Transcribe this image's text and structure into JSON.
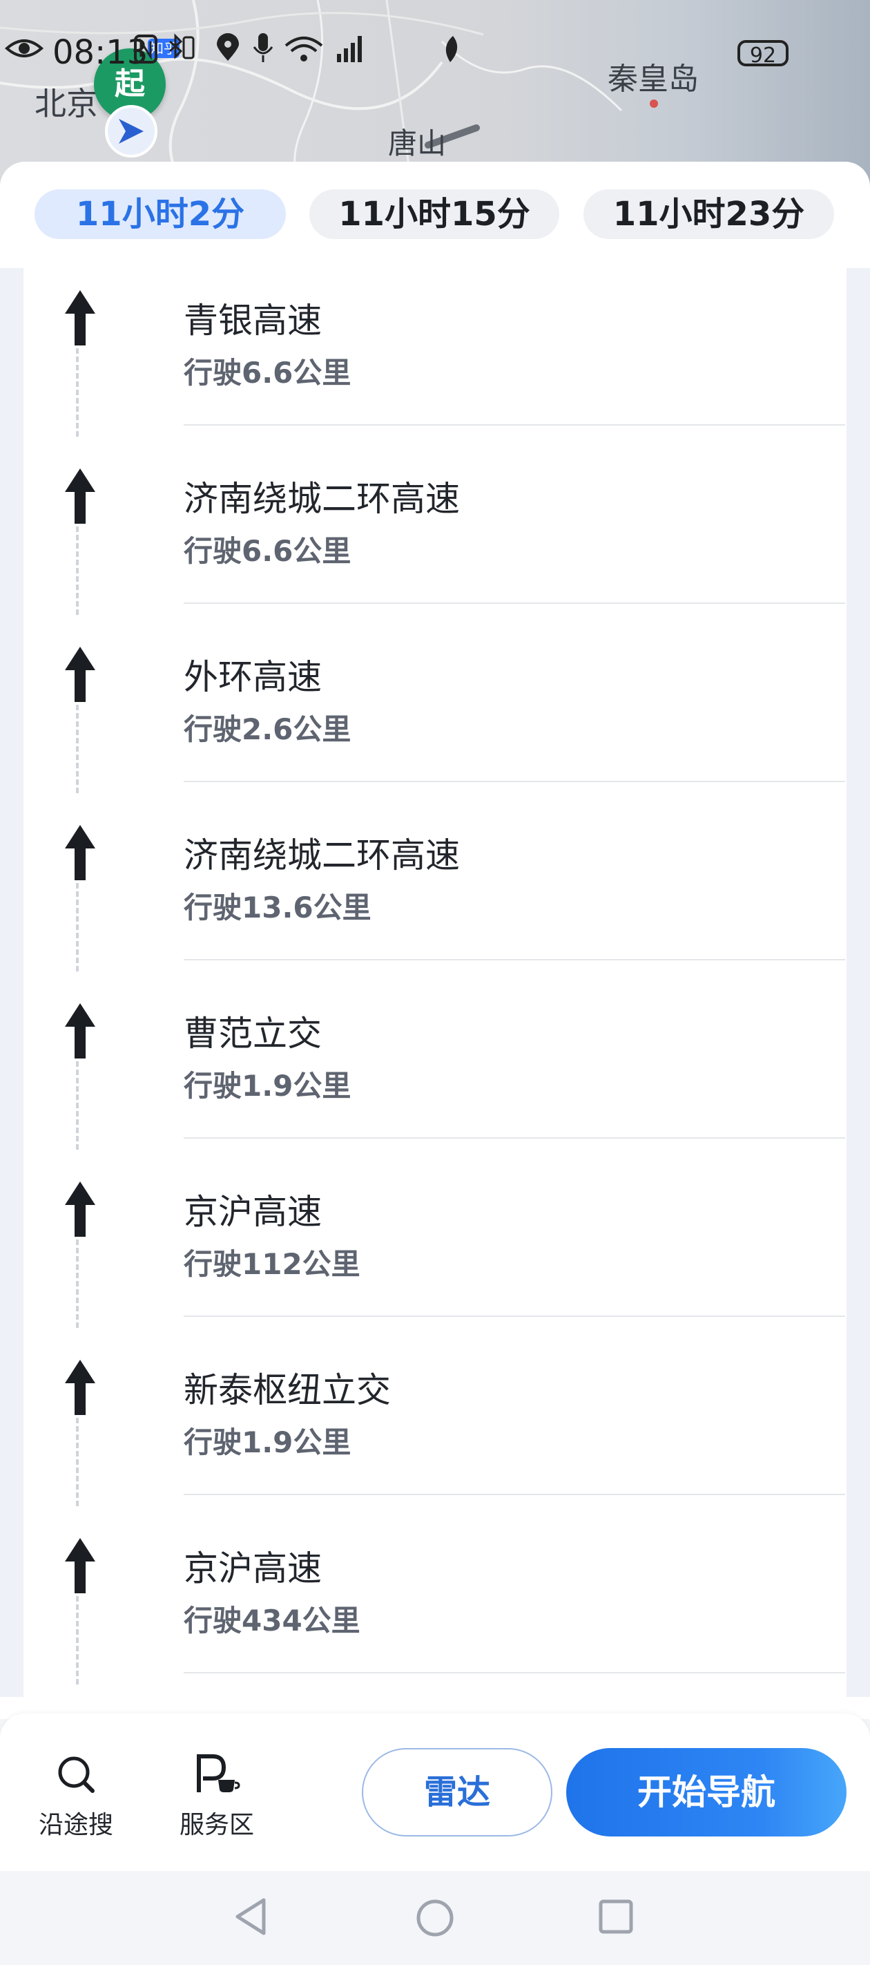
{
  "status_bar": {
    "time": "08:13",
    "app_badge": "知乎",
    "battery": "92"
  },
  "map": {
    "labels": {
      "beijing": "北京",
      "tangshan": "唐山",
      "qinhuangdao": "秦皇岛"
    },
    "start_marker": "起"
  },
  "route_tabs": [
    {
      "label": "11小时2分",
      "active": true
    },
    {
      "label": "11小时15分",
      "active": false
    },
    {
      "label": "11小时23分",
      "active": false
    }
  ],
  "steps": [
    {
      "road": "青银高速",
      "distance": "行驶6.6公里",
      "icon": "straight-arrow-icon"
    },
    {
      "road": "济南绕城二环高速",
      "distance": "行驶6.6公里",
      "icon": "straight-arrow-icon"
    },
    {
      "road": "外环高速",
      "distance": "行驶2.6公里",
      "icon": "straight-arrow-icon"
    },
    {
      "road": "济南绕城二环高速",
      "distance": "行驶13.6公里",
      "icon": "straight-arrow-icon"
    },
    {
      "road": "曹范立交",
      "distance": "行驶1.9公里",
      "icon": "straight-arrow-icon"
    },
    {
      "road": "京沪高速",
      "distance": "行驶112公里",
      "icon": "straight-arrow-icon"
    },
    {
      "road": "新泰枢纽立交",
      "distance": "行驶1.9公里",
      "icon": "straight-arrow-icon"
    },
    {
      "road": "京沪高速",
      "distance": "行驶434公里",
      "icon": "straight-arrow-icon"
    }
  ],
  "action_bar": {
    "search_along": "沿途搜",
    "service_area": "服务区",
    "radar": "雷达",
    "start_navigation": "开始导航"
  },
  "colors": {
    "accent": "#2a72e6",
    "start_marker": "#1c9a64"
  }
}
